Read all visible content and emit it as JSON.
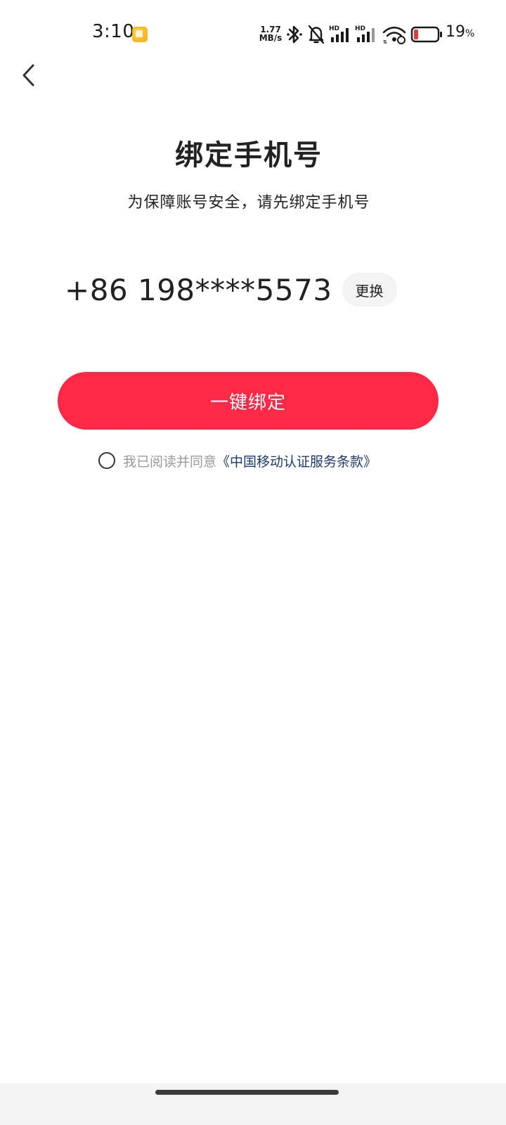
{
  "status_bar": {
    "time": "3:10",
    "app_icon": "gallery-app-icon",
    "net_speed_value": "1.77",
    "net_speed_unit": "MB/s",
    "icons": [
      "bluetooth-icon",
      "mute-bell-icon",
      "signal-hd-icon",
      "signal-hd-icon",
      "wifi-icon",
      "battery-icon"
    ],
    "battery_level": 0.19,
    "battery_percent": "19",
    "battery_percent_sign": "%",
    "battery_color": "#e53935"
  },
  "nav": {
    "back_icon": "chevron-left-icon"
  },
  "main": {
    "title": "绑定手机号",
    "subtitle": "为保障账号安全，请先绑定手机号",
    "phone_number": "+86 198****5573",
    "change_label": "更换",
    "bind_button_label": "一键绑定",
    "agreement_prefix": "我已阅读并同意",
    "agreement_link": "《中国移动认证服务条款》",
    "agreement_checked": false
  },
  "colors": {
    "primary_button": "#ff2846",
    "link": "#1f3a6e",
    "muted_text": "#9a9a9a",
    "change_button_bg": "#f3f3f3"
  }
}
